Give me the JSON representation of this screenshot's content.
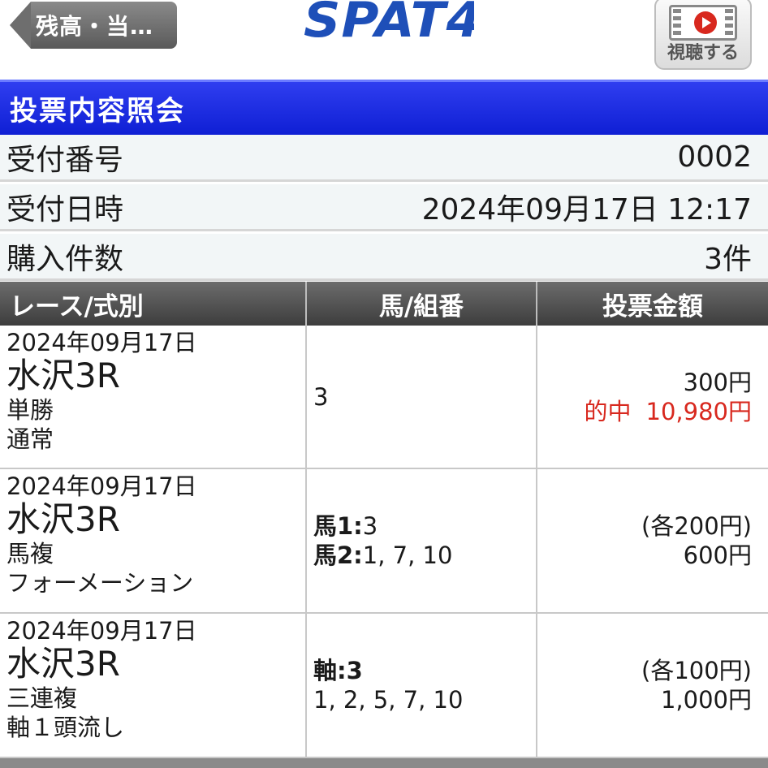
{
  "header": {
    "back_label": "残高・当…",
    "logo": "SPAT4",
    "watch_label": "視聴する"
  },
  "title": "投票内容照会",
  "info": {
    "receipt_no_label": "受付番号",
    "receipt_no": "0002",
    "receipt_time_label": "受付日時",
    "receipt_time": "2024年09月17日 12:17",
    "count_label": "購入件数",
    "count": "3件"
  },
  "table": {
    "headers": [
      "レース/式別",
      "馬/組番",
      "投票金額"
    ],
    "rows": [
      {
        "date": "2024年09月17日",
        "venue": "水沢3R",
        "bet_type": "単勝",
        "method": "通常",
        "combo": [
          {
            "label": "",
            "value": "3"
          }
        ],
        "amount_each": "",
        "amount": "300円",
        "hit_label": "的中",
        "hit_amount": "10,980円"
      },
      {
        "date": "2024年09月17日",
        "venue": "水沢3R",
        "bet_type": "馬複",
        "method": "フォーメーション",
        "combo": [
          {
            "label": "馬1:",
            "value": "3"
          },
          {
            "label": "馬2:",
            "value": "1, 7, 10"
          }
        ],
        "amount_each": "(各200円)",
        "amount": "600円"
      },
      {
        "date": "2024年09月17日",
        "venue": "水沢3R",
        "bet_type": "三連複",
        "method": "軸１頭流し",
        "combo": [
          {
            "label": "軸:",
            "value": "3"
          },
          {
            "label": "",
            "value": "1, 2, 5, 7, 10"
          }
        ],
        "amount_each": "(各100円)",
        "amount": "1,000円"
      }
    ]
  },
  "colors": {
    "title_bar": "#1a2be0",
    "hit": "#d8281e",
    "logo": "#1e4fb8"
  }
}
